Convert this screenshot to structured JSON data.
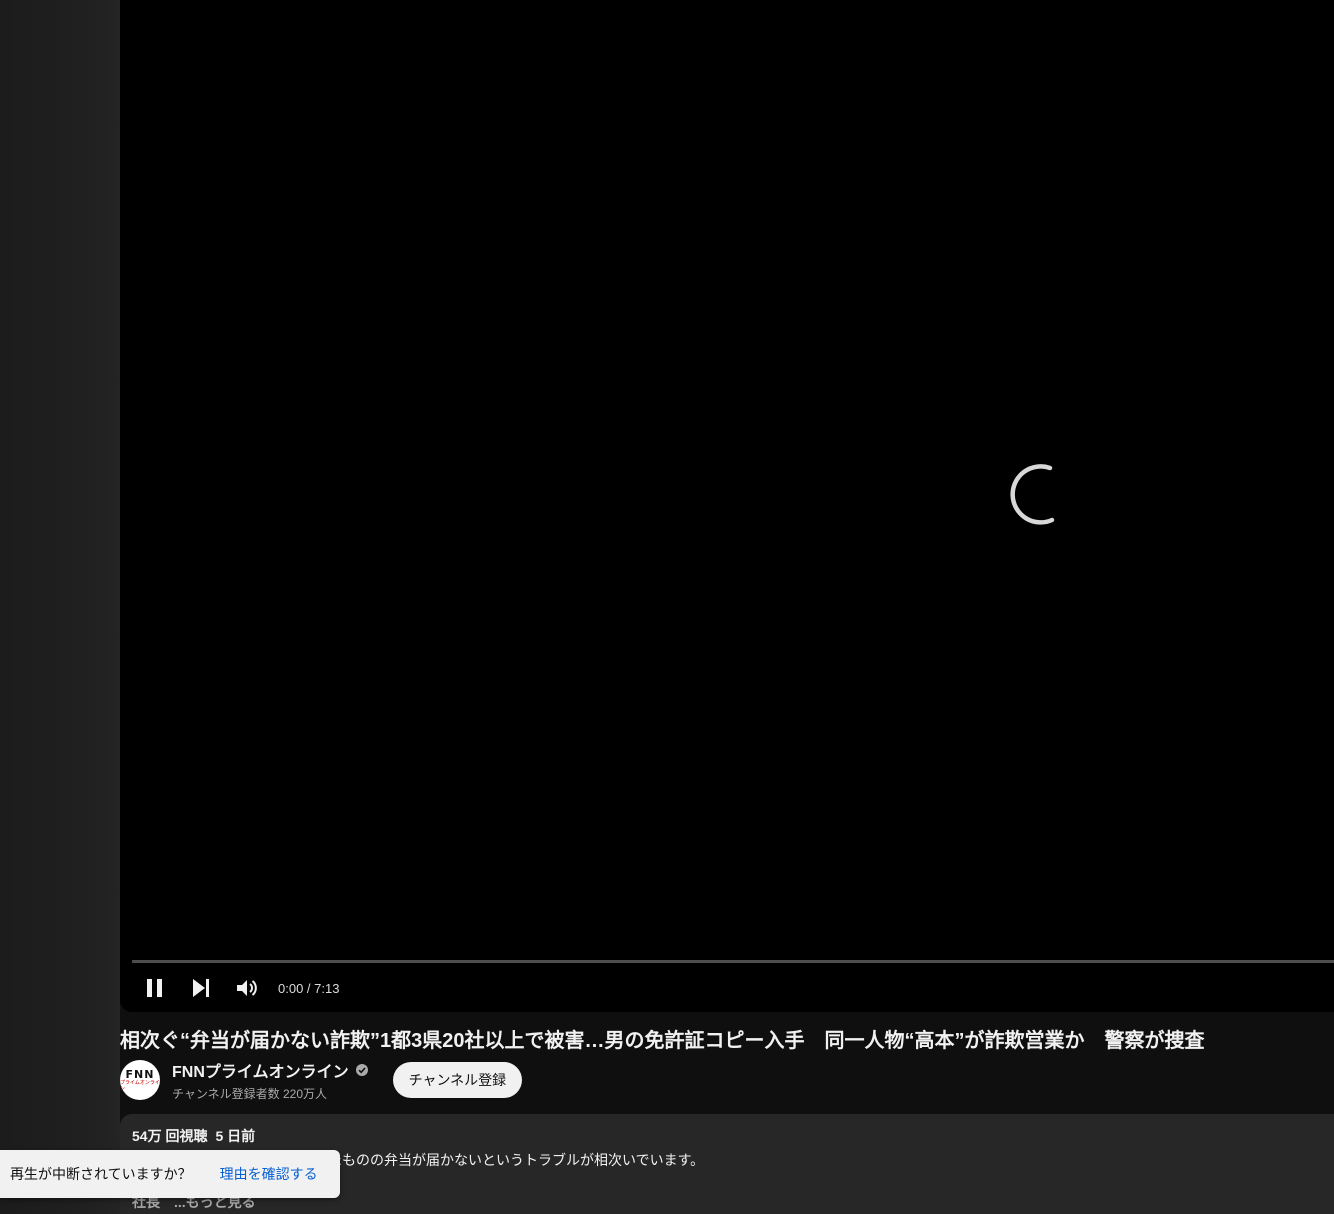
{
  "player": {
    "time_current": "0:00",
    "time_total": "7:13",
    "time_display": "0:00 / 7:13",
    "progress_fraction": 0.0,
    "state": "loading",
    "accent_color": "#ff0000"
  },
  "video": {
    "title": "相次ぐ“弁当が届かない詐欺”1都3県20社以上で被害…男の免許証コピー入手　同一人物“高本”が詐欺営業か　警察が捜査"
  },
  "channel": {
    "name": "FNNプライムオンライン",
    "verified_icon": "verified-check-icon",
    "subscribers": "チャンネル登録者数 220万人",
    "avatar_top": "FNN",
    "avatar_bottom": "プライムオンライン",
    "subscribe_label": "チャンネル登録"
  },
  "description": {
    "views": "54万 回視聴",
    "date": "5 日前",
    "line1": "弁当が届かない業者が手を回したものの弁当が届かないというトラブルが相次いでいます。",
    "more": "社長　...もっと見る"
  },
  "toast": {
    "text": "再生が中断されていますか？",
    "link": "理由を確認する"
  }
}
